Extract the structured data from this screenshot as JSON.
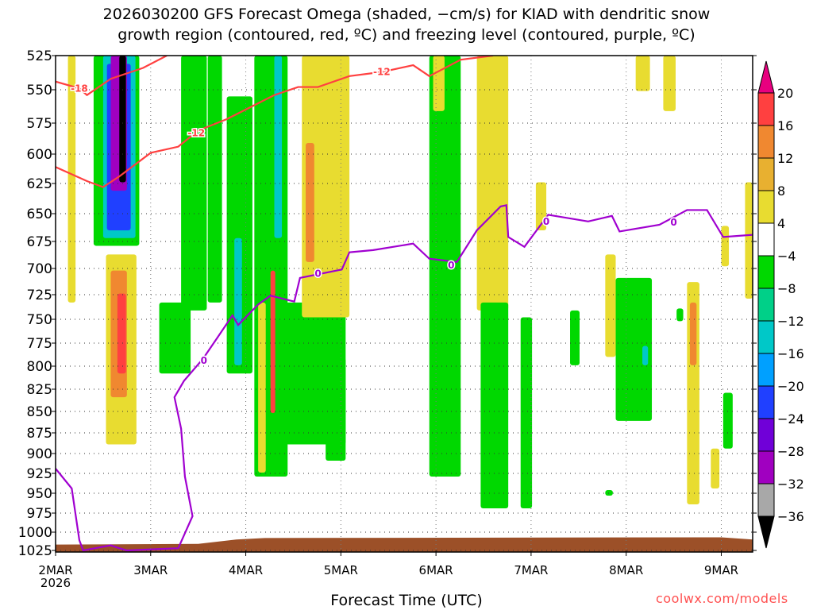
{
  "chart_data": {
    "type": "heatmap",
    "title": [
      "2026030200 GFS Forecast Omega (shaded, −cm/s) for KIAD with dendritic snow",
      "growth region (contoured, red, ºC) and freezing level (contoured, purple, ºC)"
    ],
    "xlabel": "Forecast Time (UTC)",
    "ylabel": "",
    "credit": "coolwx.com/models",
    "x_unit": "days since 2026-03-02 00Z",
    "xlim": [
      0,
      7.33
    ],
    "ylim": [
      525,
      1025
    ],
    "y_inverted": true,
    "x_ticks": [
      {
        "value": 0,
        "label": "2MAR",
        "sublabel": "2026"
      },
      {
        "value": 1,
        "label": "3MAR"
      },
      {
        "value": 2,
        "label": "4MAR"
      },
      {
        "value": 3,
        "label": "5MAR"
      },
      {
        "value": 4,
        "label": "6MAR"
      },
      {
        "value": 5,
        "label": "7MAR"
      },
      {
        "value": 6,
        "label": "8MAR"
      },
      {
        "value": 7,
        "label": "9MAR"
      }
    ],
    "y_ticks": [
      525,
      550,
      575,
      600,
      625,
      650,
      675,
      700,
      725,
      750,
      775,
      800,
      825,
      850,
      875,
      900,
      925,
      950,
      975,
      1000,
      1025
    ],
    "grid": "dotted",
    "colorbar": {
      "levels": [
        20,
        16,
        12,
        8,
        4,
        -4,
        -8,
        -12,
        -16,
        -20,
        -24,
        -28,
        -32,
        -36
      ],
      "colors": [
        "#e8007f",
        "#ff4040",
        "#f08830",
        "#e8b030",
        "#e8dc30",
        "#ffffff",
        "#00d800",
        "#00d088",
        "#00c8c8",
        "#00a0ff",
        "#2040ff",
        "#7000d8",
        "#a000c0",
        "#a8a8a8",
        "#000000"
      ],
      "placement": "right"
    },
    "shaded_regions": [
      {
        "t": [
          0.4,
          0.88
        ],
        "p": [
          525,
          679
        ],
        "v": -6
      },
      {
        "t": [
          0.5,
          0.84
        ],
        "p": [
          525,
          672
        ],
        "v": -14
      },
      {
        "t": [
          0.54,
          0.79
        ],
        "p": [
          531,
          665
        ],
        "v": -22
      },
      {
        "t": [
          0.58,
          0.75
        ],
        "p": [
          525,
          631
        ],
        "v": -30
      },
      {
        "t": [
          0.67,
          0.74
        ],
        "p": [
          525,
          624
        ],
        "v": -40
      },
      {
        "t": [
          0.13,
          0.21
        ],
        "p": [
          525,
          733
        ],
        "v": 6
      },
      {
        "t": [
          0.53,
          0.85
        ],
        "p": [
          687,
          889
        ],
        "v": 6
      },
      {
        "t": [
          0.58,
          0.75
        ],
        "p": [
          702,
          834
        ],
        "v": 14
      },
      {
        "t": [
          0.65,
          0.74
        ],
        "p": [
          724,
          808
        ],
        "v": 18
      },
      {
        "t": [
          1.09,
          1.42
        ],
        "p": [
          733,
          808
        ],
        "v": -6
      },
      {
        "t": [
          1.32,
          1.59
        ],
        "p": [
          525,
          741
        ],
        "v": -6
      },
      {
        "t": [
          1.6,
          1.75
        ],
        "p": [
          525,
          733
        ],
        "v": -6
      },
      {
        "t": [
          1.8,
          2.07
        ],
        "p": [
          555,
          808
        ],
        "v": -6
      },
      {
        "t": [
          1.88,
          1.96
        ],
        "p": [
          672,
          799
        ],
        "v": -14
      },
      {
        "t": [
          2.09,
          2.44
        ],
        "p": [
          525,
          929
        ],
        "v": -6
      },
      {
        "t": [
          2.13,
          2.21
        ],
        "p": [
          733,
          924
        ],
        "v": 6
      },
      {
        "t": [
          2.26,
          2.31
        ],
        "p": [
          702,
          852
        ],
        "v": 18
      },
      {
        "t": [
          2.3,
          2.38
        ],
        "p": [
          525,
          672
        ],
        "v": -14
      },
      {
        "t": [
          2.42,
          3.05
        ],
        "p": [
          733,
          889
        ],
        "v": -6
      },
      {
        "t": [
          2.59,
          3.09
        ],
        "p": [
          525,
          748
        ],
        "v": 6
      },
      {
        "t": [
          2.63,
          2.72
        ],
        "p": [
          591,
          694
        ],
        "v": 14
      },
      {
        "t": [
          2.84,
          3.05
        ],
        "p": [
          791,
          909
        ],
        "v": -6
      },
      {
        "t": [
          3.93,
          4.26
        ],
        "p": [
          525,
          929
        ],
        "v": -6
      },
      {
        "t": [
          3.97,
          4.09
        ],
        "p": [
          525,
          566
        ],
        "v": 6
      },
      {
        "t": [
          4.43,
          4.76
        ],
        "p": [
          525,
          741
        ],
        "v": 6
      },
      {
        "t": [
          4.47,
          4.76
        ],
        "p": [
          733,
          969
        ],
        "v": -6
      },
      {
        "t": [
          4.89,
          5.01
        ],
        "p": [
          748,
          969
        ],
        "v": -6
      },
      {
        "t": [
          5.05,
          5.16
        ],
        "p": [
          624,
          665
        ],
        "v": 6
      },
      {
        "t": [
          5.41,
          5.51
        ],
        "p": [
          741,
          799
        ],
        "v": -6
      },
      {
        "t": [
          5.78,
          5.89
        ],
        "p": [
          687,
          790
        ],
        "v": 6
      },
      {
        "t": [
          5.89,
          6.27
        ],
        "p": [
          709,
          861
        ],
        "v": -6
      },
      {
        "t": [
          6.17,
          6.23
        ],
        "p": [
          778,
          799
        ],
        "v": -14
      },
      {
        "t": [
          6.64,
          6.77
        ],
        "p": [
          713,
          964
        ],
        "v": 6
      },
      {
        "t": [
          6.67,
          6.74
        ],
        "p": [
          733,
          799
        ],
        "v": 14
      },
      {
        "t": [
          6.53,
          6.6
        ],
        "p": [
          739,
          752
        ],
        "v": -6
      },
      {
        "t": [
          6.89,
          6.98
        ],
        "p": [
          894,
          944
        ],
        "v": 6
      },
      {
        "t": [
          7.02,
          7.12
        ],
        "p": [
          829,
          894
        ],
        "v": -6
      },
      {
        "t": [
          7.25,
          7.33
        ],
        "p": [
          624,
          729
        ],
        "v": 6
      },
      {
        "t": [
          7.0,
          7.08
        ],
        "p": [
          661,
          698
        ],
        "v": 6
      },
      {
        "t": [
          6.1,
          6.25
        ],
        "p": [
          525,
          551
        ],
        "v": 6
      },
      {
        "t": [
          6.39,
          6.52
        ],
        "p": [
          525,
          566
        ],
        "v": 6
      },
      {
        "t": [
          5.78,
          5.86
        ],
        "p": [
          946,
          953
        ],
        "v": -6
      }
    ],
    "contours": [
      {
        "name": "freezing level",
        "value": 0,
        "color": "#a000d0",
        "points": [
          [
            0,
            919
          ],
          [
            0.17,
            944
          ],
          [
            0.25,
            1011
          ],
          [
            0.29,
            1025
          ],
          [
            0.58,
            1018
          ],
          [
            0.67,
            1022
          ],
          [
            0.75,
            1025
          ],
          [
            1.29,
            1022
          ],
          [
            1.44,
            979
          ],
          [
            1.36,
            929
          ],
          [
            1.32,
            870
          ],
          [
            1.25,
            834
          ],
          [
            1.35,
            816
          ],
          [
            1.55,
            792
          ],
          [
            1.71,
            768
          ],
          [
            1.86,
            746
          ],
          [
            1.92,
            756
          ],
          [
            2.13,
            735
          ],
          [
            2.26,
            726
          ],
          [
            2.51,
            732
          ],
          [
            2.57,
            709
          ],
          [
            3.01,
            701
          ],
          [
            3.09,
            685
          ],
          [
            3.34,
            683
          ],
          [
            3.76,
            677
          ],
          [
            3.93,
            691
          ],
          [
            4.22,
            694
          ],
          [
            4.43,
            665
          ],
          [
            4.68,
            644
          ],
          [
            4.74,
            643
          ],
          [
            4.76,
            671
          ],
          [
            4.93,
            680
          ],
          [
            5.18,
            651
          ],
          [
            5.6,
            657
          ],
          [
            5.85,
            652
          ],
          [
            5.93,
            666
          ],
          [
            6.35,
            660
          ],
          [
            6.64,
            647
          ],
          [
            6.85,
            647
          ],
          [
            7.02,
            671
          ],
          [
            7.33,
            669
          ]
        ],
        "labels": [
          {
            "text": "0",
            "t": 1.56,
            "p": 794
          },
          {
            "text": "0",
            "t": 2.76,
            "p": 705
          },
          {
            "text": "0",
            "t": 4.16,
            "p": 697
          },
          {
            "text": "0",
            "t": 5.16,
            "p": 657
          },
          {
            "text": "0",
            "t": 6.5,
            "p": 658
          }
        ]
      },
      {
        "name": "dendritic -12",
        "value": -12,
        "color": "#ff4040",
        "points": [
          [
            0,
            611
          ],
          [
            0.33,
            623
          ],
          [
            0.5,
            628
          ],
          [
            0.67,
            619
          ],
          [
            1.0,
            599
          ],
          [
            1.29,
            594
          ],
          [
            1.5,
            581
          ],
          [
            1.8,
            572
          ],
          [
            2.05,
            563
          ],
          [
            2.3,
            554
          ],
          [
            2.55,
            548
          ],
          [
            2.76,
            548
          ],
          [
            3.09,
            540
          ],
          [
            3.43,
            537
          ],
          [
            3.76,
            532
          ],
          [
            3.93,
            540
          ],
          [
            4.26,
            528
          ],
          [
            4.6,
            525
          ]
        ],
        "labels": [
          {
            "text": "-12",
            "t": 1.48,
            "p": 583
          },
          {
            "text": "-12",
            "t": 3.43,
            "p": 537
          }
        ]
      },
      {
        "name": "dendritic -18",
        "value": -18,
        "color": "#ff4040",
        "points": [
          [
            0,
            544
          ],
          [
            0.25,
            549
          ],
          [
            0.33,
            554
          ],
          [
            0.58,
            542
          ],
          [
            0.92,
            534
          ],
          [
            1.17,
            525
          ]
        ],
        "labels": [
          {
            "text": "-18",
            "t": 0.25,
            "p": 549
          }
        ]
      }
    ],
    "surface": {
      "color": "#9c5028",
      "points": [
        [
          0,
          1017
        ],
        [
          1.5,
          1016
        ],
        [
          1.9,
          1010
        ],
        [
          2.2,
          1008
        ],
        [
          7.0,
          1007
        ],
        [
          7.33,
          1010
        ]
      ]
    }
  }
}
